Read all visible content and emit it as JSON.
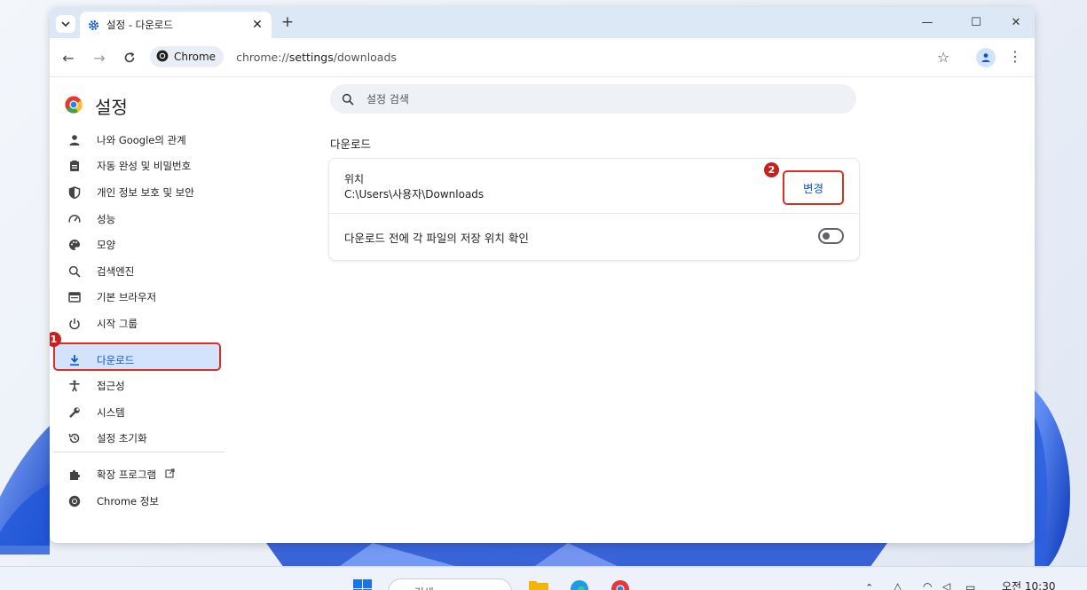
{
  "browser": {
    "tab_title": "설정 - 다운로드",
    "chip_label": "Chrome",
    "url_prefix": "chrome://",
    "url_host": "settings",
    "url_path": "/downloads"
  },
  "settings": {
    "title": "설정",
    "search_placeholder": "설정 검색",
    "sidebar": [
      {
        "label": "나와 Google의 관계",
        "icon": "person-icon"
      },
      {
        "label": "자동 완성 및 비밀번호",
        "icon": "clipboard-icon"
      },
      {
        "label": "개인 정보 보호 및 보안",
        "icon": "shield-icon"
      },
      {
        "label": "성능",
        "icon": "speedometer-icon"
      },
      {
        "label": "모양",
        "icon": "palette-icon"
      },
      {
        "label": "검색엔진",
        "icon": "search-icon"
      },
      {
        "label": "기본 브라우저",
        "icon": "browser-icon"
      },
      {
        "label": "시작 그룹",
        "icon": "power-icon"
      },
      {
        "label": "다운로드",
        "icon": "download-icon",
        "selected": true
      },
      {
        "label": "접근성",
        "icon": "accessibility-icon"
      },
      {
        "label": "시스템",
        "icon": "wrench-icon"
      },
      {
        "label": "설정 초기화",
        "icon": "reset-icon"
      },
      {
        "label": "확장 프로그램",
        "icon": "puzzle-icon"
      },
      {
        "label": "Chrome 정보",
        "icon": "chrome-icon"
      }
    ],
    "section_title": "다운로드",
    "location_label": "위치",
    "location_path": "C:\\Users\\사용자\\Downloads",
    "change_button": "변경",
    "ask_label": "다운로드 전에 각 파일의 저장 위치 확인",
    "ask_enabled": false
  },
  "annotations": {
    "step1": "1",
    "step2": "2"
  },
  "taskbar": {
    "search_placeholder": "검색",
    "clock": "오전 10:30"
  },
  "colors": {
    "accent": "#0b57d0",
    "annotation": "#d93025",
    "selected_bg": "#d3e3fd"
  }
}
